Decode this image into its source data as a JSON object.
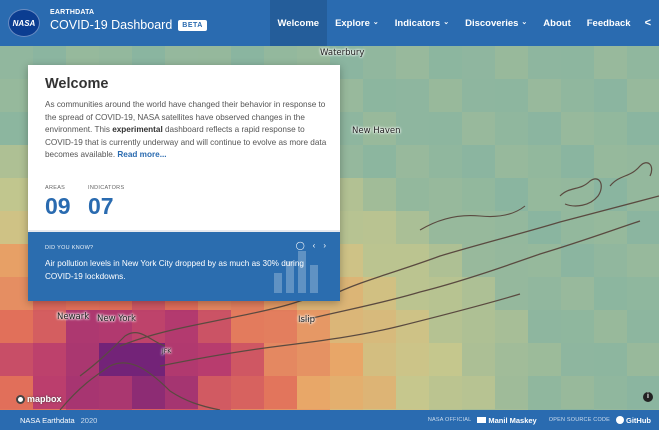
{
  "header": {
    "logo_text": "NASA",
    "brand_top": "EARTHDATA",
    "brand_title": "COVID-19 Dashboard",
    "badge": "BETA",
    "nav": [
      {
        "label": "Welcome",
        "active": true,
        "dropdown": false
      },
      {
        "label": "Explore",
        "active": false,
        "dropdown": true
      },
      {
        "label": "Indicators",
        "active": false,
        "dropdown": true
      },
      {
        "label": "Discoveries",
        "active": false,
        "dropdown": true
      },
      {
        "label": "About",
        "active": false,
        "dropdown": false
      },
      {
        "label": "Feedback",
        "active": false,
        "dropdown": false
      }
    ],
    "share_icon": "share-icon"
  },
  "map": {
    "places": [
      "Waterbury",
      "New Haven",
      "Newark",
      "New York",
      "Islip",
      "JFK"
    ],
    "attribution": "mapbox",
    "info_icon": "info-icon"
  },
  "welcome": {
    "title": "Welcome",
    "text_1": "As communities around the world have changed their behavior in response to the spread of COVID-19, NASA satellites have observed changes in the environment. This ",
    "text_bold": "experimental",
    "text_2": " dashboard reflects a rapid response to COVID-19 that is currently underway and will continue to evolve as more data becomes available. ",
    "read_more": "Read more...",
    "areas_label": "AREAS",
    "areas_value": "09",
    "indicators_label": "INDICATORS",
    "indicators_value": "07",
    "dyk_label": "DID YOU KNOW?",
    "dyk_text": "Air pollution levels in New York City dropped by as much as 30% during COVID-19 lockdowns."
  },
  "footer": {
    "left_title": "NASA Earthdata",
    "left_year": "2020",
    "official_label": "NASA OFFICIAL",
    "official_name": "Manil Maskey",
    "source_label": "OPEN SOURCE CODE",
    "source_link": "GitHub"
  },
  "colors": {
    "brand_blue": "#2a6bb0",
    "panel_blue": "#2b6daf"
  }
}
